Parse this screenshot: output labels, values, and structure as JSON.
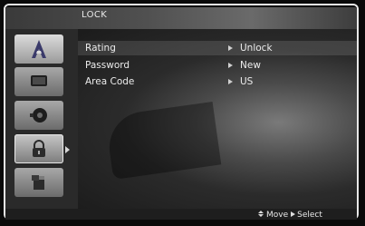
{
  "screen": {
    "title": "LOCK"
  },
  "menu": {
    "icons": [
      {
        "name": "disc-menu-icon",
        "state": "active"
      },
      {
        "name": "display-menu-icon",
        "state": "idle"
      },
      {
        "name": "audio-menu-icon",
        "state": "idle"
      },
      {
        "name": "lock-menu-icon",
        "state": "selected"
      },
      {
        "name": "others-menu-icon",
        "state": "idle"
      }
    ]
  },
  "rows": [
    {
      "label": "Rating",
      "value": "Unlock"
    },
    {
      "label": "Password",
      "value": "New"
    },
    {
      "label": "Area Code",
      "value": "US"
    }
  ],
  "footer": {
    "move": "Move",
    "select": "Select"
  }
}
